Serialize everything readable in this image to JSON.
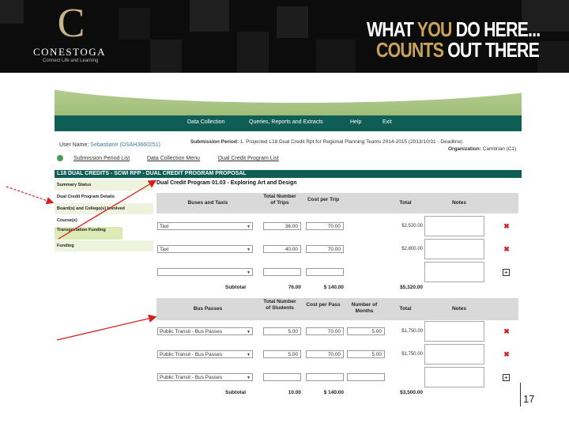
{
  "brand": {
    "logo_letter": "C",
    "name": "CONESTOGA",
    "tagline": "Connect Life and Learning",
    "slogan_line1_a": "WHAT ",
    "slogan_line1_b": "YOU",
    "slogan_line1_c": " DO HERE...",
    "slogan_line2_a": "COUNTS",
    "slogan_line2_b": " OUT THERE"
  },
  "nav": {
    "items": [
      "Data Collection",
      "Queries, Reports and Extracts",
      "Help",
      "Exit"
    ]
  },
  "user": {
    "label": "User Name:",
    "value": "SebastianIr (DSAH3660251)"
  },
  "submission": {
    "label": "Submission Period:",
    "value": "1. Projected L18 Dual Credit Rpt for Regional Planning Teams 2014-2015 (2013/10/31 - Deadline)",
    "org_label": "Organization:",
    "org_value": "Cambrian (C1)"
  },
  "links": [
    "Submission Period List",
    "Data Collection Menu",
    "Dual Credit Program List"
  ],
  "proposal_title": "L18 DUAL CREDITS - SCWI RFP - DUAL CREDIT PROGRAM PROPOSAL",
  "sidebar": [
    "Summary Status",
    "Dual Credit Program Details",
    "Board(s) and College(s) Involved",
    "Course(s)",
    "Transportation Funding",
    "Funding"
  ],
  "program_title": "Dual Credit Program 01.03 - Exploring Art and Design",
  "taxi_section": {
    "headers": [
      "Buses and Taxis",
      "Total Number of Trips",
      "Cost per Trip",
      "Total",
      "Notes"
    ],
    "rows": [
      {
        "type": "Taxi",
        "trips": "36.00",
        "cost": "70.00",
        "total": "$2,520.00"
      },
      {
        "type": "Taxi",
        "trips": "40.00",
        "cost": "70.00",
        "total": "$2,800.00"
      },
      {
        "type": "",
        "trips": "",
        "cost": "",
        "total": ""
      }
    ],
    "subtotal_label": "Subtotal",
    "subtotal_trips": "76.00",
    "subtotal_cost": "$ 140.00",
    "subtotal_total": "$5,320.00"
  },
  "bus_section": {
    "headers": [
      "Bus Passes",
      "Total Number of Students",
      "Cost per Pass",
      "Number of Months",
      "Total",
      "Notes"
    ],
    "rows": [
      {
        "type": "Public Transit - Bus Passes",
        "students": "5.00",
        "cost": "70.00",
        "months": "5.00",
        "total": "$1,750.00"
      },
      {
        "type": "Public Transit - Bus Passes",
        "students": "5.00",
        "cost": "70.00",
        "months": "5.00",
        "total": "$1,750.00"
      },
      {
        "type": "Public Transit - Bus Passes",
        "students": "",
        "cost": "",
        "months": "",
        "total": ""
      }
    ],
    "subtotal_label": "Subtotal",
    "subtotal_students": "10.00",
    "subtotal_cost": "$ 140.00",
    "subtotal_total": "$3,500.00"
  },
  "icons": {
    "delete": "delete-x-icon",
    "add": "add-plus-icon",
    "dropdown": "chevron-down-icon",
    "globe": "globe-icon"
  },
  "colors": {
    "banner_bg": "#0c0c0c",
    "gold": "#c8a45a",
    "nav_teal": "#0f5e56",
    "arrow_red": "#d42020",
    "delete_red": "#cc2222"
  },
  "page_number": "17"
}
